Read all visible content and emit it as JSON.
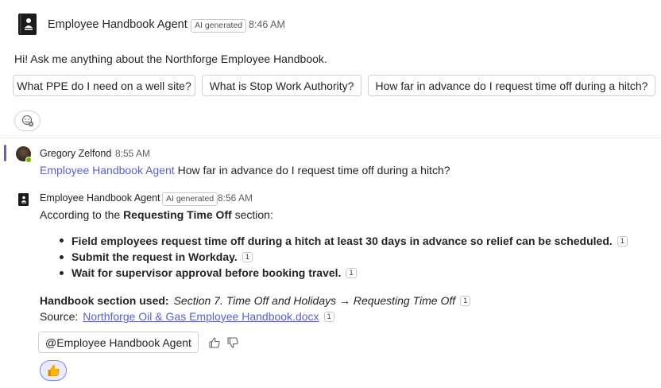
{
  "header": {
    "bot_name": "Employee Handbook Agent",
    "ai_badge": "AI generated",
    "time": "8:46 AM"
  },
  "greeting": "Hi! Ask me anything about the Northforge Employee Handbook.",
  "suggestions": [
    "What PPE do I need on a well site?",
    "What is Stop Work Authority?",
    "How far in advance do I request time off during a hitch?"
  ],
  "user_message": {
    "name": "Gregory Zelfond",
    "time": "8:55 AM",
    "mention": "Employee Handbook Agent",
    "text": "How far in advance do I request time off during a hitch?"
  },
  "bot_reply": {
    "name": "Employee Handbook Agent",
    "ai_badge": "AI generated",
    "time": "8:56 AM",
    "intro_prefix": "According to the ",
    "intro_bold": "Requesting Time Off",
    "intro_suffix": " section:",
    "bullets": [
      {
        "text": "Field employees request time off during a hitch at least 30 days in advance so relief can be scheduled.",
        "cite": "1"
      },
      {
        "text": "Submit the request in Workday.",
        "cite": "1"
      },
      {
        "text": "Wait for supervisor approval before booking travel.",
        "cite": "1"
      }
    ],
    "section_label": "Handbook section used:",
    "section_value": "Section 7. Time Off and Holidays → Requesting Time Off",
    "section_cite": "1",
    "source_label": "Source:",
    "source_link": "Northforge Oil & Gas Employee Handbook.docx",
    "source_cite": "1",
    "mention_button": "@Employee Handbook Agent"
  },
  "icons": {
    "bot_avatar": "handbook-book-icon",
    "add_reaction": "add-reaction-icon",
    "thumbs_up": "thumbs-up-icon",
    "thumbs_down": "thumbs-down-icon",
    "reaction": "thumbs-up-emoji-icon"
  },
  "colors": {
    "accent": "#5b5fc7",
    "presence": "#6bb700",
    "reaction_bg": "#ebebf9"
  }
}
